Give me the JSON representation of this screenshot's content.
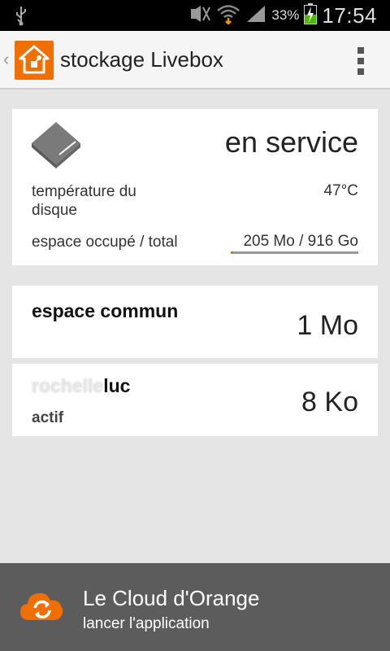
{
  "status_bar": {
    "battery": "33%",
    "time": "17:54",
    "icons": [
      "usb-icon",
      "mute-icon",
      "wifi-icon",
      "signal-icon",
      "battery-charging-icon"
    ]
  },
  "action_bar": {
    "title": "stockage Livebox",
    "app_icon": "livebox-home-icon",
    "menu_icon": "overflow-menu-icon"
  },
  "disk_card": {
    "status": "en service",
    "temperature_label": "température du disque",
    "temperature_value": "47°C",
    "space_label": "espace occupé / total",
    "space_value": "205 Mo / 916 Go",
    "usage_fraction": 0.02,
    "colors": {
      "accent": "#f16e00",
      "icon": "#777777"
    }
  },
  "storage_items": [
    {
      "name": "espace commun",
      "size": "1 Mo"
    },
    {
      "name_hidden": "rochelle",
      "name": "luc",
      "status": "actif",
      "size": "8 Ko"
    }
  ],
  "cloud_banner": {
    "title": "Le Cloud d'Orange",
    "subtitle": "lancer l'application",
    "icon": "orange-cloud-sync-icon",
    "background": "#5c5c5c"
  }
}
